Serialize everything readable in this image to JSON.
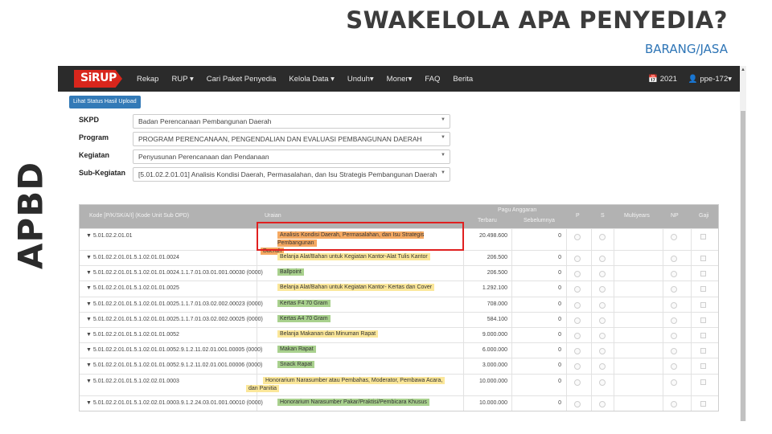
{
  "slide": {
    "title": "SWAKELOLA APA PENYEDIA?",
    "subtitle": "BARANG/JASA",
    "side_label": "APBD"
  },
  "navbar": {
    "logo_text": "SiRUP",
    "items": [
      "Rekap",
      "RUP ▾",
      "Cari Paket Penyedia",
      "Kelola Data ▾",
      "Unduh▾",
      "Moner▾",
      "FAQ",
      "Berita"
    ],
    "year": "📅 2021",
    "user": "👤 ppe-172▾"
  },
  "status_button": "Lihat Status Hasil Upload",
  "form": {
    "skpd": {
      "label": "SKPD",
      "value": "Badan Perencanaan Pembangunan Daerah"
    },
    "program": {
      "label": "Program",
      "value": "PROGRAM PERENCANAAN, PENGENDALIAN DAN EVALUASI PEMBANGUNAN DAERAH"
    },
    "kegiatan": {
      "label": "Kegiatan",
      "value": "Penyusunan Perencanaan dan Pendanaan"
    },
    "subkegiatan": {
      "label": "Sub-Kegiatan",
      "value": "[5.01.02.2.01.01] Analisis Kondisi Daerah, Permasalahan, dan Isu Strategis Pembangunan Daerah"
    }
  },
  "table": {
    "headers": {
      "kode": "Kode [P/K/SK/A/I] (Kode Unit Sub OPD)",
      "uraian": "Uraian",
      "pagu": "Pagu Anggaran",
      "terbaru": "Terbaru",
      "sebelumnya": "Sebelumnya",
      "p": "P",
      "s": "S",
      "multiyears": "Multiyears",
      "np": "NP",
      "gaji": "Gaji"
    },
    "colors": {
      "orange": "#f5a962",
      "yellow": "#fbe79a",
      "green": "#a9d18e"
    },
    "rows": [
      {
        "kode": "▼ 5.01.02.2.01.01",
        "uraian": "Analisis Kondisi Daerah, Permasalahan, dan Isu Strategis Pembangunan Daerah",
        "uraian_line1": "Analisis Kondisi Daerah, Permasalahan, dan Isu Strategis Pembangunan",
        "uraian_line2": "Daerah",
        "hl": "orange",
        "terbaru": "20.498.600",
        "sebelumnya": "0",
        "tall": true
      },
      {
        "kode": "▼ 5.01.02.2.01.01.5.1.02.01.01.0024",
        "uraian_line1": "Belanja Alat/Bahan untuk Kegiatan Kantor-Alat Tulis Kantor",
        "hl": "yellow",
        "terbaru": "206.500",
        "sebelumnya": "0"
      },
      {
        "kode": "▼ 5.01.02.2.01.01.5.1.02.01.01.0024.1.1.7.01.03.01.001.00030 (0000)",
        "uraian_line1": "Ballpoint",
        "hl": "green",
        "terbaru": "206.500",
        "sebelumnya": "0"
      },
      {
        "kode": "▼ 5.01.02.2.01.01.5.1.02.01.01.0025",
        "uraian_line1": "Belanja Alat/Bahan untuk Kegiatan Kantor- Kertas dan Cover",
        "hl": "yellow",
        "terbaru": "1.292.100",
        "sebelumnya": "0"
      },
      {
        "kode": "▼ 5.01.02.2.01.01.5.1.02.01.01.0025.1.1.7.01.03.02.002.00023 (0000)",
        "uraian_line1": "Kertas F4 70 Gram",
        "hl": "green",
        "terbaru": "708.000",
        "sebelumnya": "0"
      },
      {
        "kode": "▼ 5.01.02.2.01.01.5.1.02.01.01.0025.1.1.7.01.03.02.002.00025 (0000)",
        "uraian_line1": "Kertas A4 70 Gram",
        "hl": "green",
        "terbaru": "584.100",
        "sebelumnya": "0"
      },
      {
        "kode": "▼ 5.01.02.2.01.01.5.1.02.01.01.0052",
        "uraian_line1": "Belanja Makanan dan Minuman Rapat",
        "hl": "yellow",
        "terbaru": "9.000.000",
        "sebelumnya": "0"
      },
      {
        "kode": "▼ 5.01.02.2.01.01.5.1.02.01.01.0052.9.1.2.11.02.01.001.00005 (0000)",
        "uraian_line1": "Makan Rapat",
        "hl": "green",
        "terbaru": "6.000.000",
        "sebelumnya": "0"
      },
      {
        "kode": "▼ 5.01.02.2.01.01.5.1.02.01.01.0052.9.1.2.11.02.01.001.00006 (0000)",
        "uraian_line1": "Snack Rapat",
        "hl": "green",
        "terbaru": "3.000.000",
        "sebelumnya": "0"
      },
      {
        "kode": "▼ 5.01.02.2.01.01.5.1.02.02.01.0003",
        "uraian_line1": "Honorarium Narasumber atau Pembahas, Moderator, Pembawa Acara,",
        "uraian_line2": "dan Panitia",
        "hl": "yellow",
        "terbaru": "10.000.000",
        "sebelumnya": "0",
        "tall": true
      },
      {
        "kode": "▼ 5.01.02.2.01.01.5.1.02.02.01.0003.9.1.2.24.03.01.001.00010 (0000)",
        "uraian_line1": "Honorarium Narasumber Pakar/Praktisi/Pembicara Khusus",
        "hl": "green",
        "terbaru": "10.000.000",
        "sebelumnya": "0"
      }
    ]
  }
}
